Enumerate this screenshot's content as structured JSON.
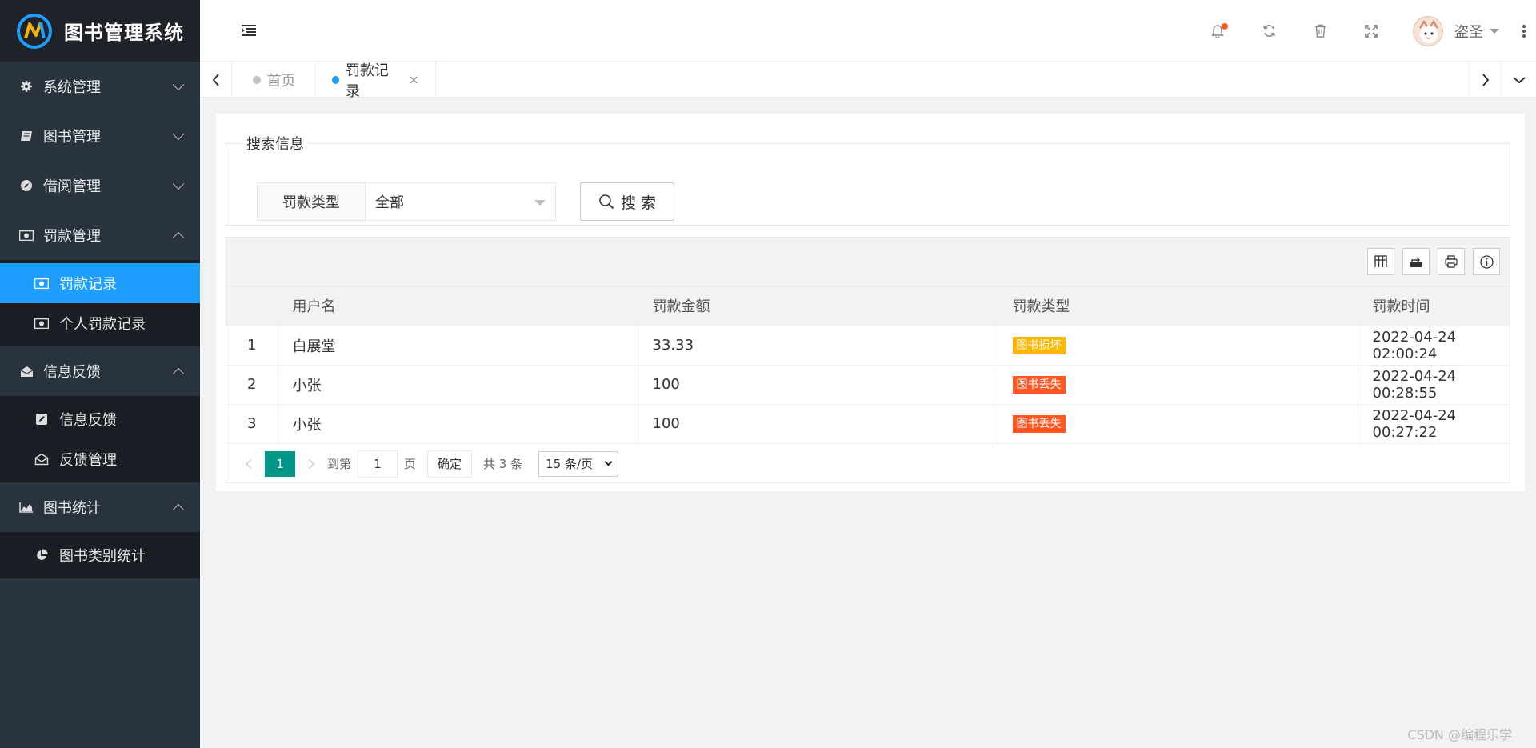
{
  "app": {
    "title": "图书管理系统"
  },
  "sidebar": {
    "groups": [
      {
        "label": "系统管理",
        "icon": "gear-icon",
        "expanded": false,
        "items": []
      },
      {
        "label": "图书管理",
        "icon": "book-icon",
        "expanded": false,
        "items": []
      },
      {
        "label": "借阅管理",
        "icon": "compass-icon",
        "expanded": false,
        "items": []
      },
      {
        "label": "罚款管理",
        "icon": "money-icon",
        "expanded": true,
        "items": [
          {
            "label": "罚款记录",
            "icon": "money-icon",
            "active": true
          },
          {
            "label": "个人罚款记录",
            "icon": "money-icon",
            "active": false
          }
        ]
      },
      {
        "label": "信息反馈",
        "icon": "envelope-open-icon",
        "expanded": true,
        "items": [
          {
            "label": "信息反馈",
            "icon": "edit-icon",
            "active": false
          },
          {
            "label": "反馈管理",
            "icon": "envelope-open-icon",
            "active": false
          }
        ]
      },
      {
        "label": "图书统计",
        "icon": "area-chart-icon",
        "expanded": true,
        "items": [
          {
            "label": "图书类别统计",
            "icon": "pie-chart-icon",
            "active": false
          }
        ]
      }
    ]
  },
  "header": {
    "icons": [
      "bell-icon",
      "refresh-icon",
      "trash-icon",
      "fullscreen-icon"
    ],
    "user": {
      "name": "盗圣"
    }
  },
  "tabs": [
    {
      "label": "首页",
      "active": false
    },
    {
      "label": "罚款记录",
      "active": true,
      "closable": true,
      "close_glyph": "×"
    }
  ],
  "search": {
    "legend": "搜索信息",
    "field_label": "罚款类型",
    "field_value": "全部",
    "button_label": "搜 索"
  },
  "table": {
    "toolbar_icons": [
      "columns-icon",
      "export-icon",
      "print-icon",
      "info-icon"
    ],
    "columns": [
      "",
      "用户名",
      "罚款金额",
      "罚款类型",
      "罚款时间"
    ],
    "rows": [
      {
        "index": "1",
        "username": "白展堂",
        "amount": "33.33",
        "type": "图书损坏",
        "type_color": "#ffb800",
        "time": "2022-04-24 02:00:24"
      },
      {
        "index": "2",
        "username": "小张",
        "amount": "100",
        "type": "图书丢失",
        "type_color": "#ff5722",
        "time": "2022-04-24 00:28:55"
      },
      {
        "index": "3",
        "username": "小张",
        "amount": "100",
        "type": "图书丢失",
        "type_color": "#ff5722",
        "time": "2022-04-24 00:27:22"
      }
    ]
  },
  "pager": {
    "current": "1",
    "goto_label": "到第",
    "goto_value": "1",
    "page_label": "页",
    "confirm_label": "确定",
    "total_label": "共 3 条",
    "limit_label": "15 条/页"
  },
  "watermark": "CSDN @编程乐学"
}
